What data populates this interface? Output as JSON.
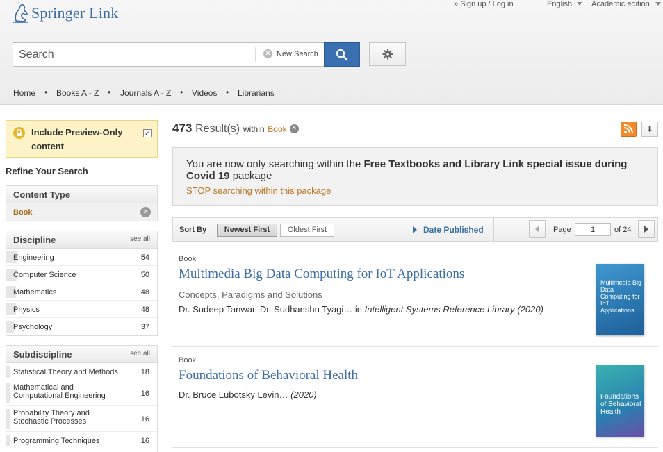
{
  "header": {
    "logo_text_bold": "Springer",
    "logo_text": "Link",
    "signup_login": "» Sign up / Log in",
    "language": "English",
    "edition": "Academic edition",
    "search_placeholder": "Search",
    "new_search_label": "New Search"
  },
  "nav": {
    "items": [
      "Home",
      "Books A - Z",
      "Journals A - Z",
      "Videos",
      "Librarians"
    ],
    "separator": "•"
  },
  "sidebar": {
    "preview_line1": "Include Preview-Only",
    "preview_line2": "content",
    "preview_checked": true,
    "refine_title": "Refine Your Search",
    "content_type": {
      "title": "Content Type",
      "selected": "Book"
    },
    "discipline": {
      "title": "Discipline",
      "see_all": "see all",
      "items": [
        {
          "name": "Engineering",
          "count": "54"
        },
        {
          "name": "Computer Science",
          "count": "50"
        },
        {
          "name": "Mathematics",
          "count": "48"
        },
        {
          "name": "Physics",
          "count": "48"
        },
        {
          "name": "Psychology",
          "count": "37"
        }
      ]
    },
    "subdiscipline": {
      "title": "Subdiscipline",
      "see_all": "see all",
      "items": [
        {
          "name": "Statistical Theory and Methods",
          "count": "18"
        },
        {
          "name": "Mathematical and Computational Engineering",
          "count": "16"
        },
        {
          "name": "Probability Theory and Stochastic Processes",
          "count": "16"
        },
        {
          "name": "Programming Techniques",
          "count": "16"
        }
      ]
    }
  },
  "results": {
    "count": "473",
    "results_word": "Result(s)",
    "within": "within",
    "filter": "Book"
  },
  "notice": {
    "prefix": "You are now only searching within the",
    "package_name": "Free Textbooks and Library Link special issue during Covid 19",
    "suffix": "package",
    "stop_link": "STOP searching within this package"
  },
  "sortbar": {
    "label": "Sort By",
    "newest": "Newest First",
    "oldest": "Oldest First",
    "date_published": "Date Published",
    "page_label": "Page",
    "page_value": "1",
    "page_total": "of 24"
  },
  "items": [
    {
      "type": "Book",
      "title": "Multimedia Big Data Computing for IoT Applications",
      "subtitle": "Concepts, Paradigms and Solutions",
      "authors": "Dr. Sudeep Tanwar, Dr. Sudhanshu Tyagi…",
      "in": "in",
      "series": "Intelligent Systems Reference Library (2020)",
      "cover_title": "Multimedia Big Data Computing for IoT Applications",
      "cover_color": "#2c7fb8"
    },
    {
      "type": "Book",
      "title": "Foundations of Behavioral Health",
      "authors": "Dr. Bruce Lubotsky Levin…",
      "year": "(2020)",
      "cover_title": "Foundations of Behavioral Health",
      "cover_color": "#2a9aa5"
    }
  ]
}
